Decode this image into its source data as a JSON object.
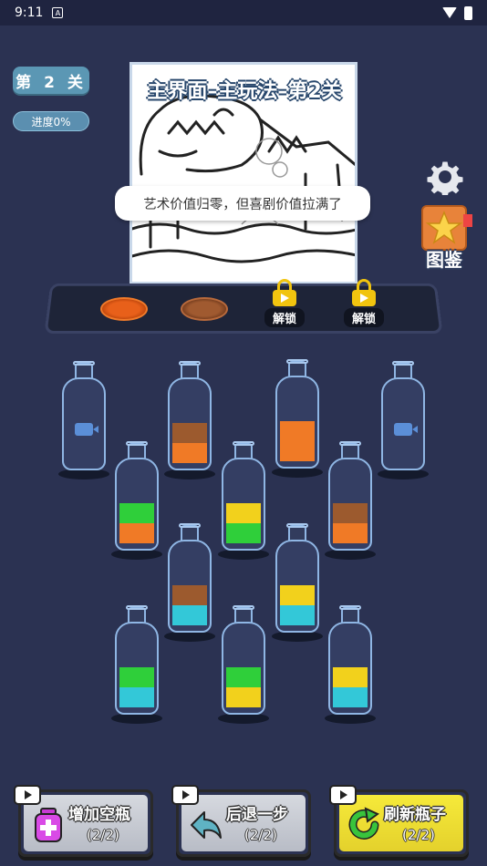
{
  "status_bar": {
    "time": "9:11",
    "notification_glyph": "A"
  },
  "level": {
    "label": "第 2 关",
    "progress": "进度0%"
  },
  "header": {
    "title": "主界面–主玩法–第2关"
  },
  "picture": {
    "speech": "艺术价值归零，但喜剧价值拉满了"
  },
  "side": {
    "collection_label": "图鉴"
  },
  "tray": {
    "plates": [
      {
        "color": "#e8601a"
      },
      {
        "color": "#a05a30"
      }
    ],
    "locks": [
      {
        "label": "解锁"
      },
      {
        "label": "解锁"
      }
    ]
  },
  "colors": {
    "orange": "#f07a26",
    "brown": "#9c5a2e",
    "green": "#2fcf3a",
    "yellow": "#f2d11c",
    "cyan": "#33c8d8"
  },
  "bottles": [
    {
      "locked": true,
      "layers": []
    },
    {
      "locked": false,
      "layers": [
        "orange",
        "brown"
      ]
    },
    {
      "locked": false,
      "layers": [
        "orange",
        "orange"
      ]
    },
    {
      "locked": true,
      "layers": []
    },
    {
      "locked": false,
      "layers": [
        "orange",
        "green"
      ]
    },
    {
      "locked": false,
      "layers": [
        "green",
        "yellow"
      ]
    },
    {
      "locked": false,
      "layers": [
        "orange",
        "brown"
      ]
    },
    {
      "locked": false,
      "layers": [
        "cyan",
        "brown"
      ]
    },
    {
      "locked": false,
      "layers": [
        "cyan",
        "yellow"
      ]
    },
    {
      "locked": false,
      "layers": [
        "cyan",
        "green"
      ]
    },
    {
      "locked": false,
      "layers": [
        "yellow",
        "green"
      ]
    },
    {
      "locked": false,
      "layers": [
        "cyan",
        "yellow"
      ]
    }
  ],
  "actions": {
    "add_bottle": {
      "title": "增加空瓶",
      "count": "(2/2)"
    },
    "undo": {
      "title": "后退一步",
      "count": "(2/2)"
    },
    "refresh": {
      "title": "刷新瓶子",
      "count": "(2/2)"
    }
  }
}
